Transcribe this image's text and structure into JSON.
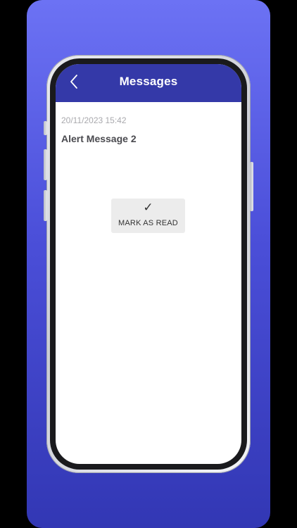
{
  "header": {
    "title": "Messages",
    "back_icon": "chevron-left-icon"
  },
  "message": {
    "date": "20/11/2023 15:42",
    "title": "Alert Message 2"
  },
  "actions": {
    "mark_read_icon": "✓",
    "mark_read_label": "MARK AS READ"
  },
  "colors": {
    "header_bg": "#3439a8",
    "promo_gradient_top": "#6c72f4",
    "promo_gradient_bottom": "#3237b4"
  }
}
